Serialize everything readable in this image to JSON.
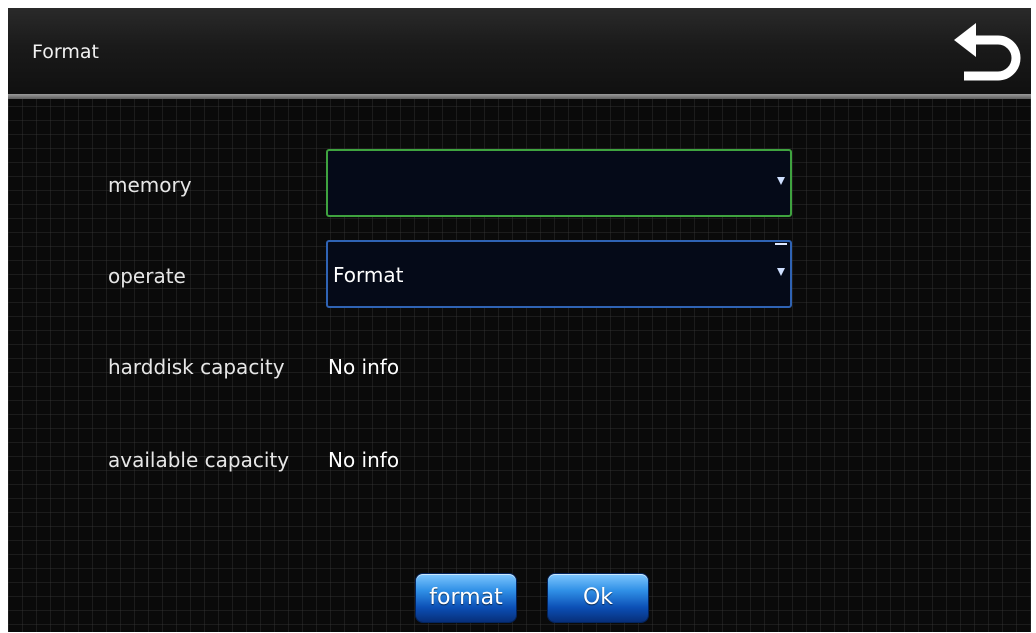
{
  "header": {
    "title": "Format",
    "back_icon": "back-arrow-icon"
  },
  "form": {
    "memory": {
      "label": "memory",
      "value": ""
    },
    "operate": {
      "label": "operate",
      "value": "Format"
    },
    "harddisk_capacity": {
      "label": "harddisk capacity",
      "value": "No info"
    },
    "available_capacity": {
      "label": "available capacity",
      "value": "No info"
    }
  },
  "actions": {
    "format_label": "format",
    "ok_label": "Ok"
  },
  "colors": {
    "focus_border": "#3fa33f",
    "select_border": "#2f63b4",
    "button_blue": "#0c4fb5"
  }
}
